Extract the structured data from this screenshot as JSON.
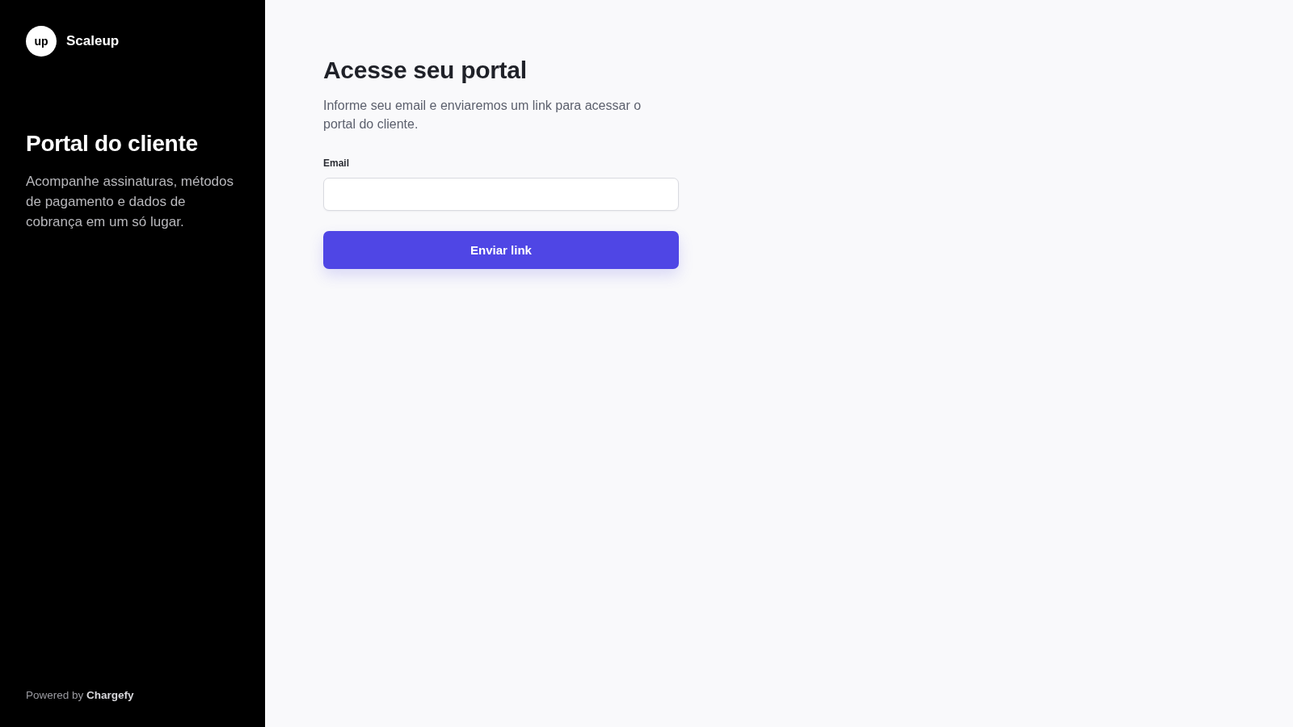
{
  "sidebar": {
    "brand": {
      "logo_text": "up",
      "name": "Scaleup"
    },
    "title": "Portal do cliente",
    "description": "Acompanhe assinaturas, métodos de pagamento e dados de cobrança em um só lugar.",
    "footer": "Powered by **Chargefy**"
  },
  "main": {
    "title": "Acesse seu portal",
    "description": "Informe seu email e enviaremos um link para acessar o portal do cliente.",
    "email_field": {
      "label": "Email"
    },
    "submit_button": {
      "label": "Enviar link"
    }
  }
}
